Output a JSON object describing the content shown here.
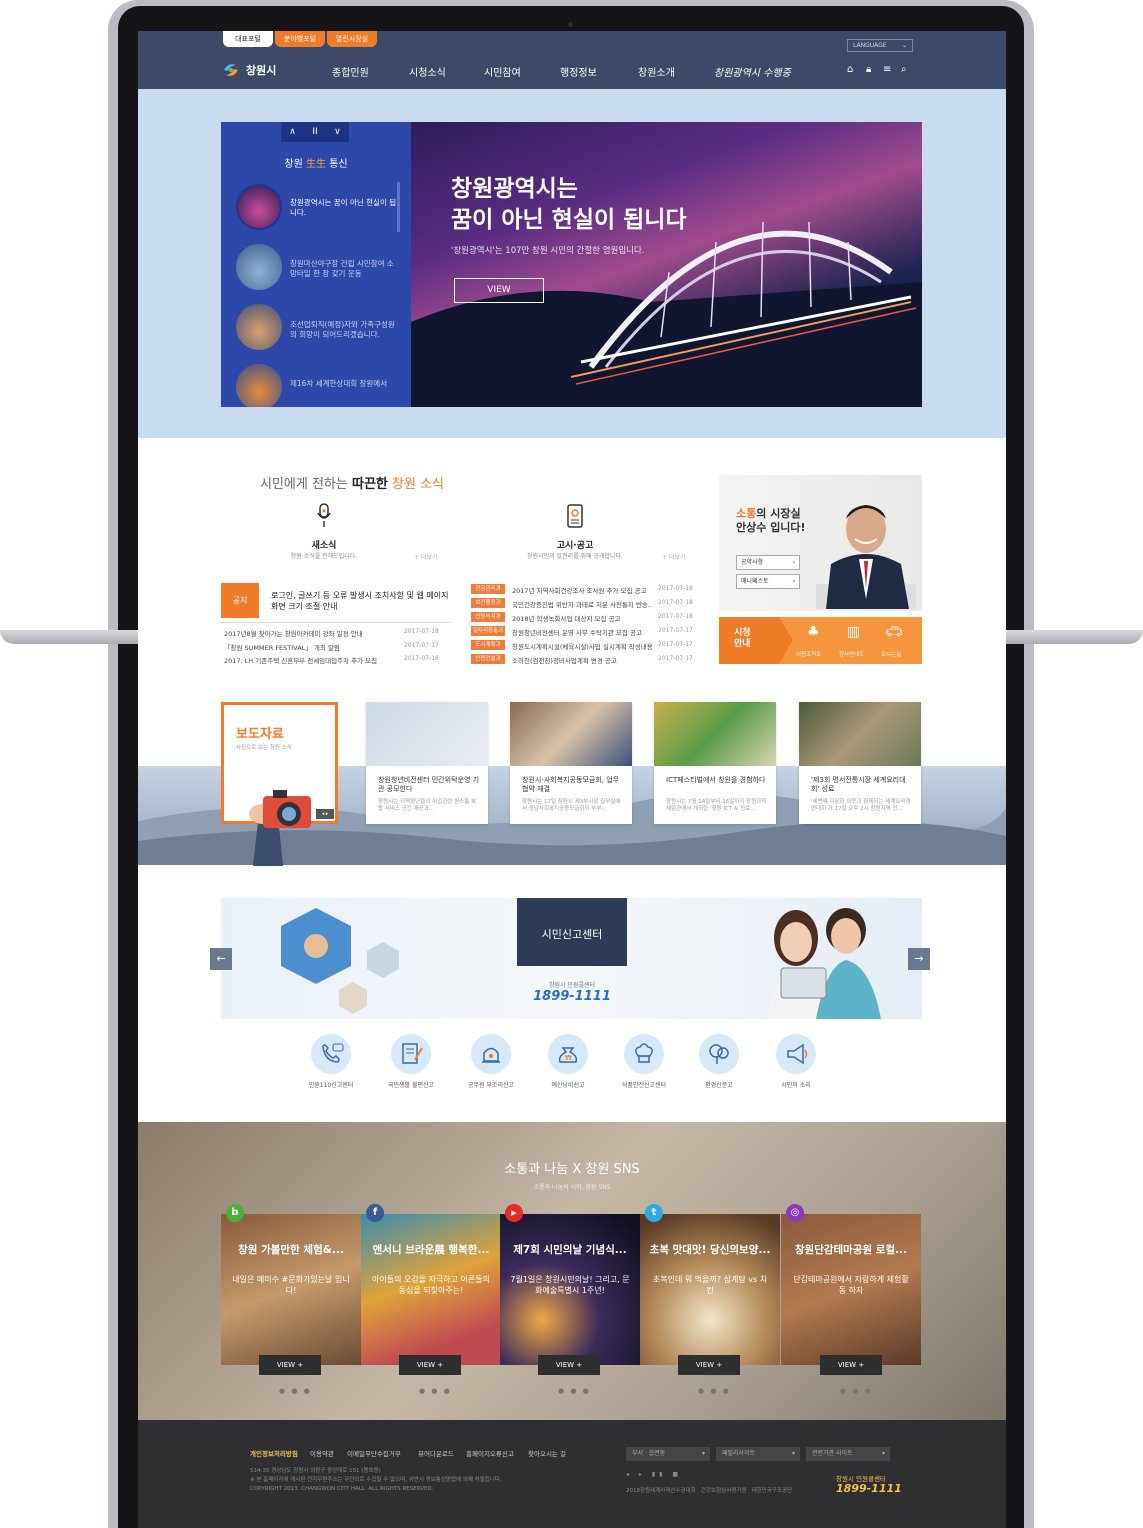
{
  "header": {
    "top_tabs": [
      "대표포털",
      "분야별포털",
      "열린시장실"
    ],
    "logo_text": "창원시",
    "nav": [
      "종합민원",
      "시청소식",
      "시민참여",
      "행정정보",
      "창원소개"
    ],
    "slogan": "창원광역시 수행중",
    "language": "LANGUAGE"
  },
  "hero": {
    "controls": [
      "∧",
      "II",
      "∨"
    ],
    "list_title_prefix": "창원",
    "list_title_accent": "生生",
    "list_title_suffix": "통신",
    "items": [
      "창원광역시는 꿈이 아닌 현실이 됩니다.",
      "창원마산야구장 건립 시민참여 소망타일 한 장 갖기 운동",
      "조선업퇴직(예정)자와 가족구성원의 희망이 되어드리겠습니다.",
      "제16차 세계한상대회 창원에서"
    ],
    "headline_line1": "창원광역시는",
    "headline_line2": "꿈이 아닌 현실이 됩니다",
    "subtext": "'창원광역시'는 107만 창원 시민의 간절한 염원입니다.",
    "view_label": "VIEW"
  },
  "news": {
    "title_prefix": "시민에게 전하는",
    "title_bold": "따끈한",
    "title_accent": "창원 소식",
    "col1_title": "새소식",
    "col1_sub": "창원 소식을 전해드립니다.",
    "col2_title": "고시·공고",
    "col2_sub": "창원시민의 알권리를 위해 공개합니다.",
    "more": "+ 더보기",
    "notice_tag": "공지",
    "notice_text": "로그인, 글쓰기 등 오류 발생시 조치사항 및 웹 페이지 화면 크기 조절 안내",
    "col1_rows": [
      {
        "text": "2017년8월 찾아가는 창원아카데미 강좌 일정 안내",
        "date": "2017-07-18"
      },
      {
        "text": "「창원 SUMMER FESTIVAL」 개최 알림",
        "date": "2017-07-17"
      },
      {
        "text": "2017. LH 기존주택 신혼부부 전세임대입주자 추가 모집",
        "date": "2017-07-16"
      }
    ],
    "col2_rows": [
      {
        "tag": "건강관리과",
        "text": "2017년 지역사회건강조사 조사원 추가 모집 공고",
        "date": "2017-07-18"
      },
      {
        "tag": "보건행정과",
        "text": "국민건강증진법 위반자 과태료 처분 사전통지 반송...",
        "date": "2017-07-18"
      },
      {
        "tag": "산림녹지과",
        "text": "2018년 학생녹화사업 대상지 모집 공고",
        "date": "2017-07-18"
      },
      {
        "tag": "일자리창출과",
        "text": "창원청년비전센터 운영 사무 수탁기관 모집 공고",
        "date": "2017-07-17"
      },
      {
        "tag": "도시계획과",
        "text": "창원도시계획시설(체육시설)사업 실시계획 작성내용...",
        "date": "2017-07-17"
      },
      {
        "tag": "안전건설과",
        "text": "소하천(검천천)정비사업계획 변경 공고",
        "date": "2017-07-17"
      }
    ]
  },
  "mayor": {
    "accent": "소통",
    "line1": "의 시장실",
    "line2": "안상수 입니다!",
    "btn1": "공약사항",
    "btn2": "매니페스토",
    "tour_label_1": "시청",
    "tour_label_2": "안내",
    "tour_items": [
      "시청조직도",
      "청사안내도",
      "오시는길"
    ]
  },
  "press": {
    "box_title": "보도자료",
    "box_sub": "사진으로 보는 창원 소식",
    "cards": [
      {
        "title": "창원청년비전센터 민간위탁운영 기관 공모한다",
        "desc": "창원시는 지역청년들의 취업관련 원스톱 복합 서비스 공간 제공과..."
      },
      {
        "title": "창원시-사회복지공동모금회, 업무협약 체결",
        "desc": "창원시는 17일 창원시 제3부시장 집무실에서 경남사회복지공동모금회와 부부..."
      },
      {
        "title": "ICT페스티벌에서 창원을 경험하다",
        "desc": "창원시는 7월 14일부터 16일까지 창원과학체험관에서 개최한 '창원 ICT & 진로..."
      },
      {
        "title": "'제3회 명서전통시장 세계요리대회' 성료",
        "desc": "'세번째 다문화 이웃과 함께하는 세계요리경연대회'가 17일 오후 2시 창원지역 전..."
      }
    ]
  },
  "report": {
    "title": "시민신고센터",
    "sub": "창원시 민원콜센터",
    "phone": "1899-1111",
    "icons": [
      "민원110신고센터",
      "국민생활 불편신고",
      "공무원 부조리신고",
      "예산낭비신고",
      "식품안전신고센터",
      "환경신문고",
      "시민의 소리"
    ]
  },
  "sns": {
    "title": "소통과 나눔 X 창원 SNS",
    "sub": "소통과 나눔의 시작, 창원 SNS",
    "view_label": "VIEW +",
    "dots": "● ● ●",
    "cards": [
      {
        "icon": "b",
        "title": "창원 가볼만한 체험&...",
        "desc": "내일은 매미수 #문화가있는날 입니다!"
      },
      {
        "icon": "f",
        "title": "앤서니 브라운展 행복한...",
        "desc": "아이들의 오감을 자극하고 어른들의 동심을 되찾아주는!"
      },
      {
        "icon": "▶",
        "title": "제7회 시민의날 기념식...",
        "desc": "7월1일은 창원시민의날! 그리고, 문화예술특별시 1주년!"
      },
      {
        "icon": "t",
        "title": "초복 맛대맛! 당신의보양...",
        "desc": "초복인데 뭐 먹을까? 삼계탕 vs 치킨"
      },
      {
        "icon": "◎",
        "title": "창원단감테마공원 로컬...",
        "desc": "단감테마공원에서 자랑하게 체험활동 하자"
      }
    ],
    "colors": {
      "blog": "#4aae3f",
      "facebook": "#3b5998",
      "youtube": "#e52d27",
      "twitter": "#2fa8e6",
      "instagram": "#8a3ab9"
    }
  },
  "footer": {
    "links": [
      "개인정보처리방침",
      "이용약관",
      "이메일무단수집거부",
      "뷰어다운로드",
      "홈페이지오류신고",
      "찾아오시는 길"
    ],
    "address": "514-35 경상남도 창원시 의창구 중앙대로 151 (용호동)",
    "notice": "※ 본 홈페이지에 게시된 전자우편주소는 무단으로 수집될 수 없으며, 위반시 정보통신망법에 의해 처벌됩니다.",
    "copyright": "COPYRIGHT 2013. CHANGWON CITY HALL. ALL RIGHTS RESERVED.",
    "selects": [
      "부서 · 읍면동",
      "패밀리사이트",
      "관련기관 사이트"
    ],
    "banners": "2018창원세계사격선수권대회   건강보험심사평가원   대한민국구조공단",
    "callcenter_label": "창원시 민원콜센터",
    "callcenter_phone": "1899-1111"
  },
  "colors": {
    "navy": "#3c4968",
    "orange": "#f07c2a",
    "hero_blue": "#2c49a9",
    "light_blue": "#c9dcef"
  }
}
